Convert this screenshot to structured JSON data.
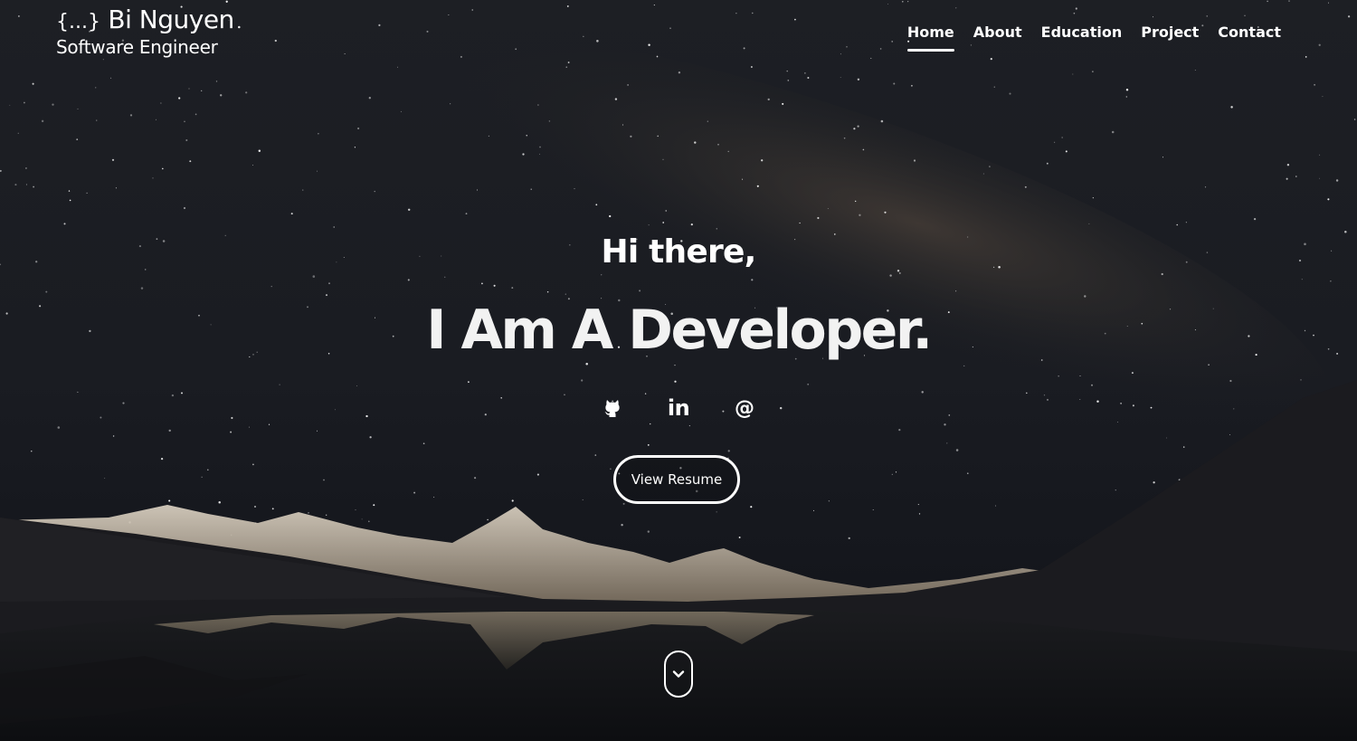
{
  "brand": {
    "braces": "{...}",
    "name": "Bi Nguyen",
    "tagline": "Software Engineer"
  },
  "nav": {
    "items": [
      {
        "label": "Home",
        "active": true
      },
      {
        "label": "About",
        "active": false
      },
      {
        "label": "Education",
        "active": false
      },
      {
        "label": "Project",
        "active": false
      },
      {
        "label": "Contact",
        "active": false
      }
    ]
  },
  "hero": {
    "greeting": "Hi there,",
    "headline": "I Am A Developer."
  },
  "socials": [
    {
      "icon": "github-icon"
    },
    {
      "icon": "linkedin-icon",
      "glyph": "in"
    },
    {
      "icon": "email-icon",
      "glyph": "@"
    }
  ],
  "resume_button": {
    "label": "View Resume"
  },
  "scroll_down": {
    "icon": "chevron-down-icon"
  },
  "colors": {
    "sky_dark": "#14171f",
    "sky_glow": "#4a4038",
    "mountain_snow": "#cfc3b0",
    "text": "#ffffff"
  }
}
